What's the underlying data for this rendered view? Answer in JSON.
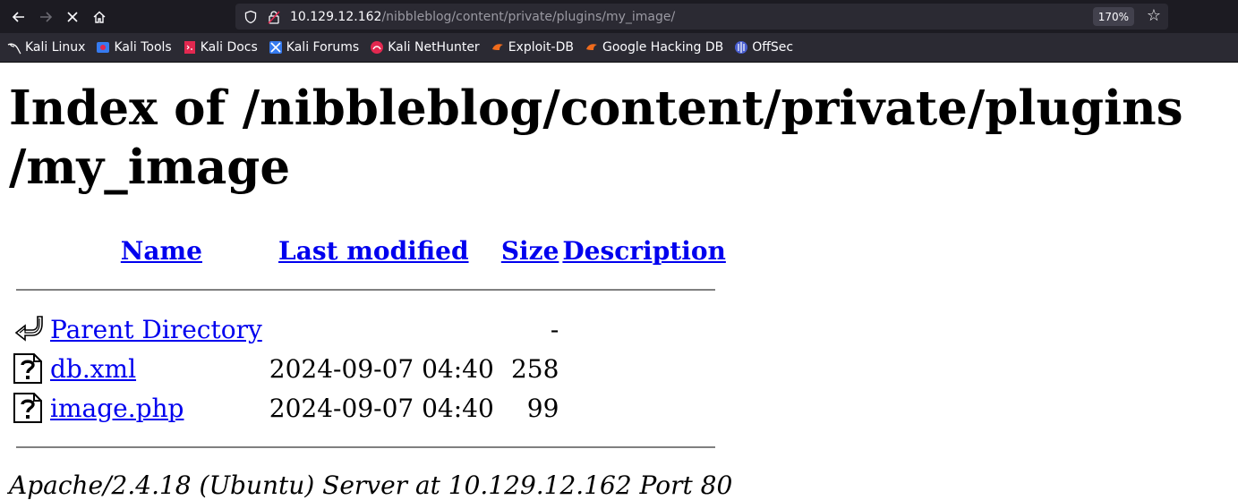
{
  "browser": {
    "url_host": "10.129.12.162",
    "url_path": "/nibbleblog/content/private/plugins/my_image/",
    "zoom": "170%"
  },
  "bookmarks": [
    {
      "label": "Kali Linux",
      "icon": "kali-dragon-icon"
    },
    {
      "label": "Kali Tools",
      "icon": "kali-tools-icon"
    },
    {
      "label": "Kali Docs",
      "icon": "kali-docs-icon"
    },
    {
      "label": "Kali Forums",
      "icon": "kali-forums-icon"
    },
    {
      "label": "Kali NetHunter",
      "icon": "nethunter-icon"
    },
    {
      "label": "Exploit-DB",
      "icon": "exploit-db-icon"
    },
    {
      "label": "Google Hacking DB",
      "icon": "ghdb-icon"
    },
    {
      "label": "OffSec",
      "icon": "offsec-icon"
    }
  ],
  "page": {
    "title_line1": "Index of /nibbleblog/content/private/plugins",
    "title_line2": "/my_image",
    "columns": {
      "name": "Name",
      "last_modified": "Last modified",
      "size": "Size",
      "description": "Description"
    },
    "rows": [
      {
        "name": "Parent Directory",
        "modified": "",
        "size": "-",
        "icon": "back-arrow-icon"
      },
      {
        "name": "db.xml",
        "modified": "2024-09-07 04:40",
        "size": "258",
        "icon": "unknown-file-icon"
      },
      {
        "name": "image.php",
        "modified": "2024-09-07 04:40",
        "size": "99",
        "icon": "unknown-file-icon"
      }
    ],
    "footer": "Apache/2.4.18 (Ubuntu) Server at 10.129.12.162 Port 80"
  }
}
